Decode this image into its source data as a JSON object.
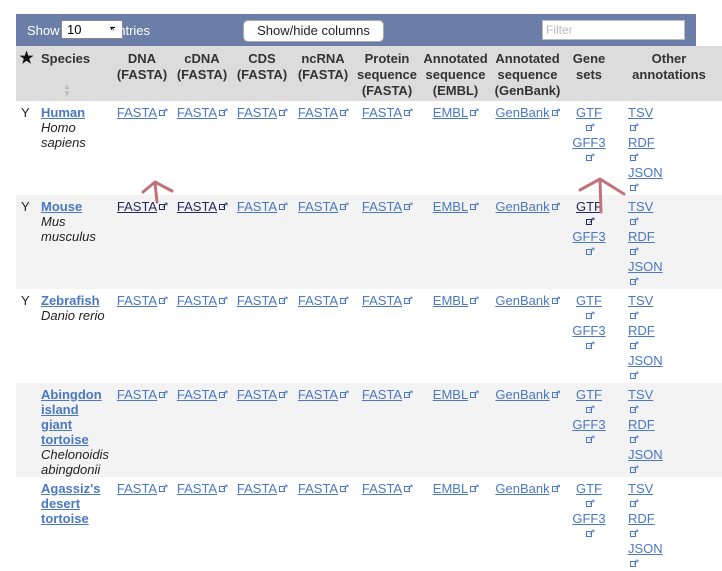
{
  "toolbar": {
    "show_label": "Show",
    "page_length": "10",
    "entries_label": "entries",
    "columns_button": "Show/hide columns",
    "filter_placeholder": "Filter"
  },
  "columns": {
    "star": "★",
    "species": "Species",
    "dna": [
      "DNA",
      "(FASTA)"
    ],
    "cdna": [
      "cDNA",
      "(FASTA)"
    ],
    "cds": [
      "CDS",
      "(FASTA)"
    ],
    "ncrna": [
      "ncRNA",
      "(FASTA)"
    ],
    "protein": [
      "Protein",
      "sequence",
      "(FASTA)"
    ],
    "embl": [
      "Annotated",
      "sequence",
      "(EMBL)"
    ],
    "genbank": [
      "Annotated",
      "sequence",
      "(GenBank)"
    ],
    "genesets": [
      "Gene",
      "sets"
    ],
    "other": [
      "Other",
      "annotations"
    ]
  },
  "rows": [
    {
      "fav": "Y",
      "name_lines": [
        "Human"
      ],
      "sci_lines": [
        "Homo",
        "sapiens"
      ]
    },
    {
      "fav": "Y",
      "name_lines": [
        "Mouse"
      ],
      "sci_lines": [
        "Mus",
        "musculus"
      ]
    },
    {
      "fav": "Y",
      "name_lines": [
        "Zebrafish"
      ],
      "sci_lines": [
        "Danio rerio"
      ]
    },
    {
      "fav": "",
      "name_lines": [
        "Abingdon",
        "island",
        "giant",
        "tortoise"
      ],
      "sci_lines": [
        "Chelonoidis",
        "abingdonii"
      ]
    },
    {
      "fav": "",
      "name_lines": [
        "Agassiz's",
        "desert",
        "tortoise"
      ],
      "sci_lines": []
    }
  ],
  "links": {
    "fasta": "FASTA",
    "embl": "EMBL",
    "genbank": "GenBank",
    "gtf": "GTF",
    "gff3": "GFF3",
    "tsv": "TSV",
    "rdf": "RDF",
    "json": "JSON"
  },
  "colors": {
    "toolbar": "#6a7ea8",
    "header": "#dcdcdc",
    "link": "#4a78c2",
    "visited_link": "#23275e",
    "annotation_arrow": "#c0737a"
  }
}
